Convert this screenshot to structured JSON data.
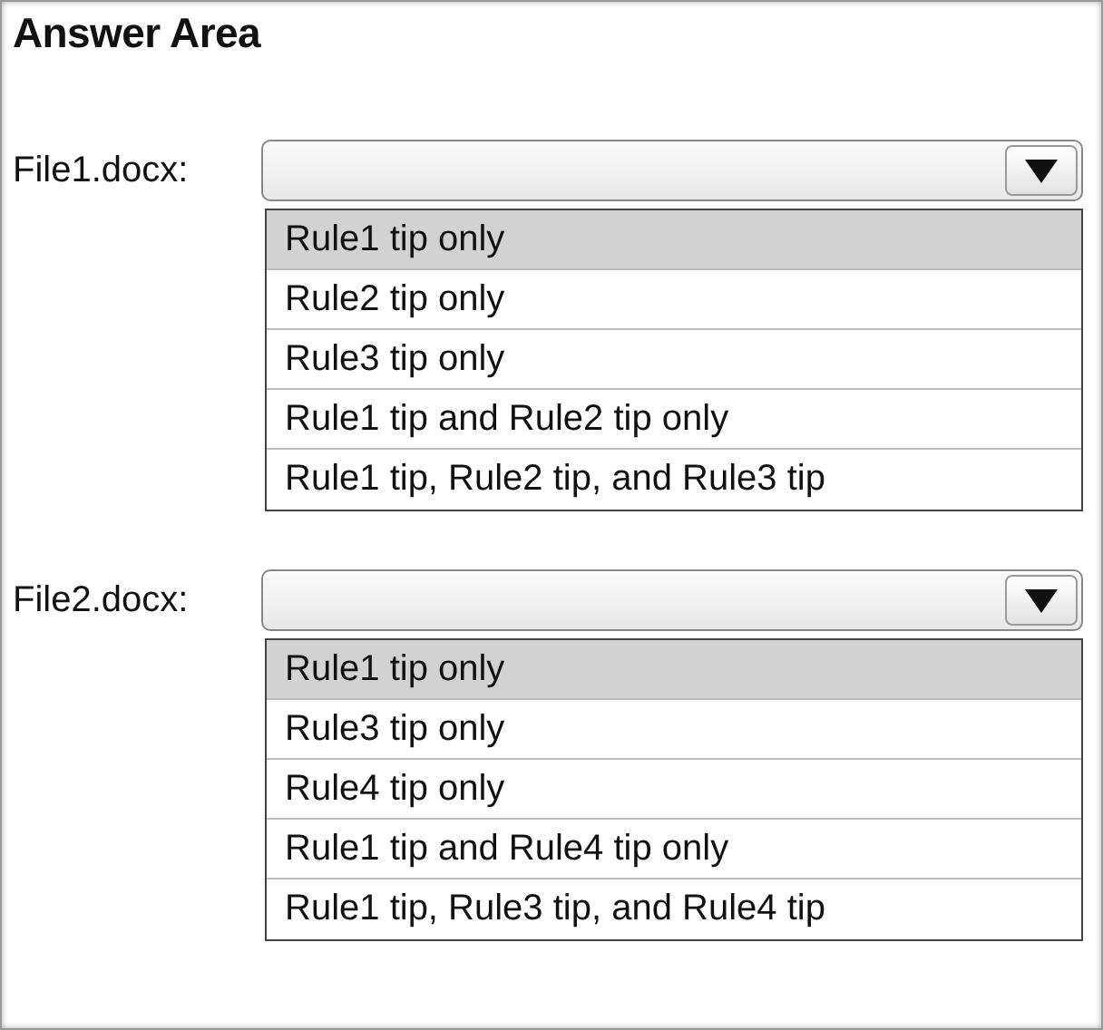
{
  "title": "Answer Area",
  "dropdowns": [
    {
      "label": "File1.docx:",
      "options": [
        {
          "text": "Rule1 tip only",
          "selected": true
        },
        {
          "text": "Rule2 tip only",
          "selected": false
        },
        {
          "text": "Rule3 tip only",
          "selected": false
        },
        {
          "text": "Rule1 tip and Rule2 tip only",
          "selected": false
        },
        {
          "text": "Rule1 tip, Rule2 tip, and Rule3 tip",
          "selected": false
        }
      ]
    },
    {
      "label": "File2.docx:",
      "options": [
        {
          "text": "Rule1 tip only",
          "selected": true
        },
        {
          "text": "Rule3 tip only",
          "selected": false
        },
        {
          "text": "Rule4 tip only",
          "selected": false
        },
        {
          "text": "Rule1 tip and Rule4 tip only",
          "selected": false
        },
        {
          "text": "Rule1 tip, Rule3 tip, and Rule4 tip",
          "selected": false
        }
      ]
    }
  ]
}
